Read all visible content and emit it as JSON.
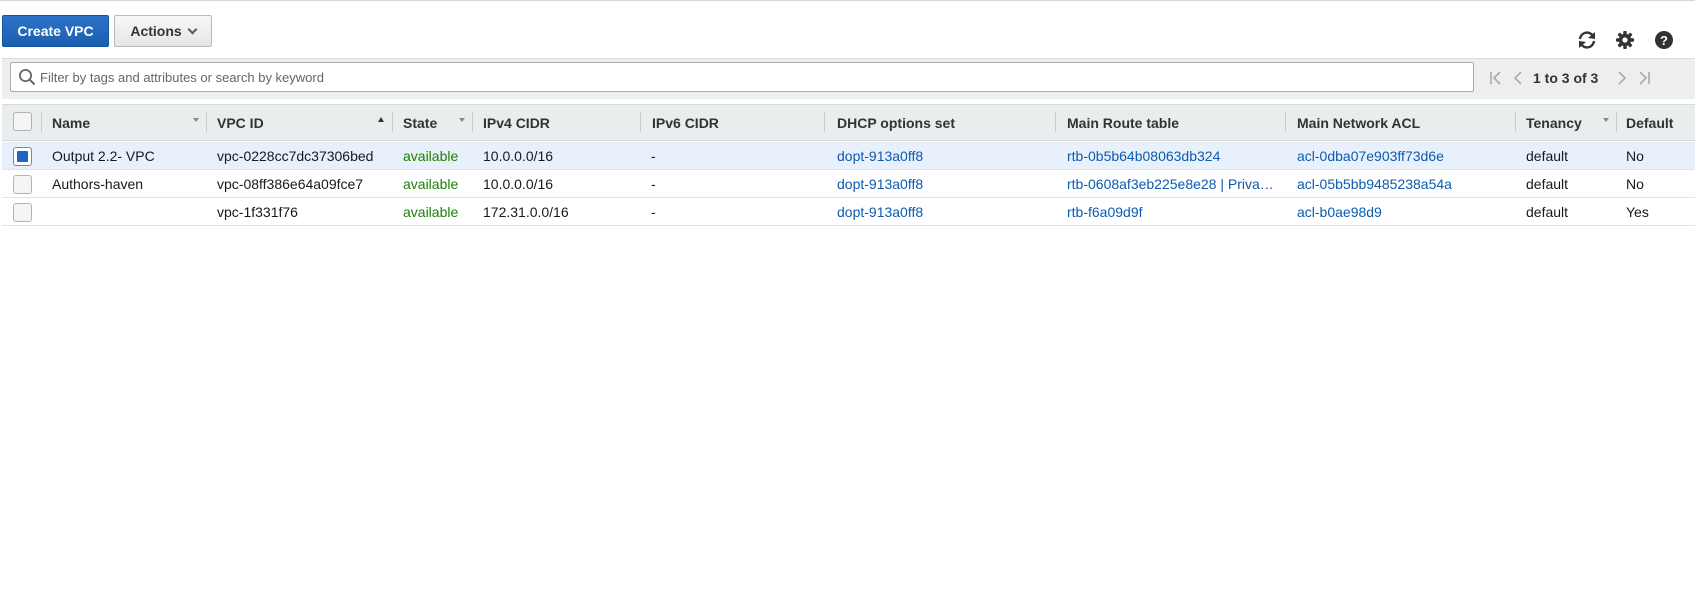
{
  "toolbar": {
    "create_label": "Create VPC",
    "actions_label": "Actions",
    "icons": [
      "refresh-icon",
      "gear-icon",
      "help-icon"
    ]
  },
  "search": {
    "placeholder": "Filter by tags and attributes or search by keyword",
    "value": ""
  },
  "pagination": {
    "text": "1 to 3 of 3",
    "icons": [
      "first-page-icon",
      "prev-page-icon",
      "next-page-icon",
      "last-page-icon"
    ]
  },
  "table": {
    "columns": {
      "name": "Name",
      "vpc_id": "VPC ID",
      "state": "State",
      "ipv4": "IPv4 CIDR",
      "ipv6": "IPv6 CIDR",
      "dhcp": "DHCP options set",
      "route": "Main Route table",
      "acl": "Main Network ACL",
      "tenancy": "Tenancy",
      "default": "Default"
    },
    "rows": [
      {
        "selected": true,
        "name": "Output 2.2- VPC",
        "vpc_id": "vpc-0228cc7dc37306bed",
        "state": "available",
        "ipv4": "10.0.0.0/16",
        "ipv6": "-",
        "dhcp": "dopt-913a0ff8",
        "route": "rtb-0b5b64b08063db324",
        "acl": "acl-0dba07e903ff73d6e",
        "tenancy": "default",
        "default": "No"
      },
      {
        "selected": false,
        "name": "Authors-haven",
        "vpc_id": "vpc-08ff386e64a09fce7",
        "state": "available",
        "ipv4": "10.0.0.0/16",
        "ipv6": "-",
        "dhcp": "dopt-913a0ff8",
        "route": "rtb-0608af3eb225e8e28 | Priva…",
        "acl": "acl-05b5bb9485238a54a",
        "tenancy": "default",
        "default": "No"
      },
      {
        "selected": false,
        "name": "",
        "vpc_id": "vpc-1f331f76",
        "state": "available",
        "ipv4": "172.31.0.0/16",
        "ipv6": "-",
        "dhcp": "dopt-913a0ff8",
        "route": "rtb-f6a09d9f",
        "acl": "acl-b0ae98d9",
        "tenancy": "default",
        "default": "Yes"
      }
    ]
  },
  "colors": {
    "primary": "#1f65c8",
    "link": "#0b5bb0",
    "status_available": "#1d8102",
    "selected_row": "#e8f1fb"
  }
}
